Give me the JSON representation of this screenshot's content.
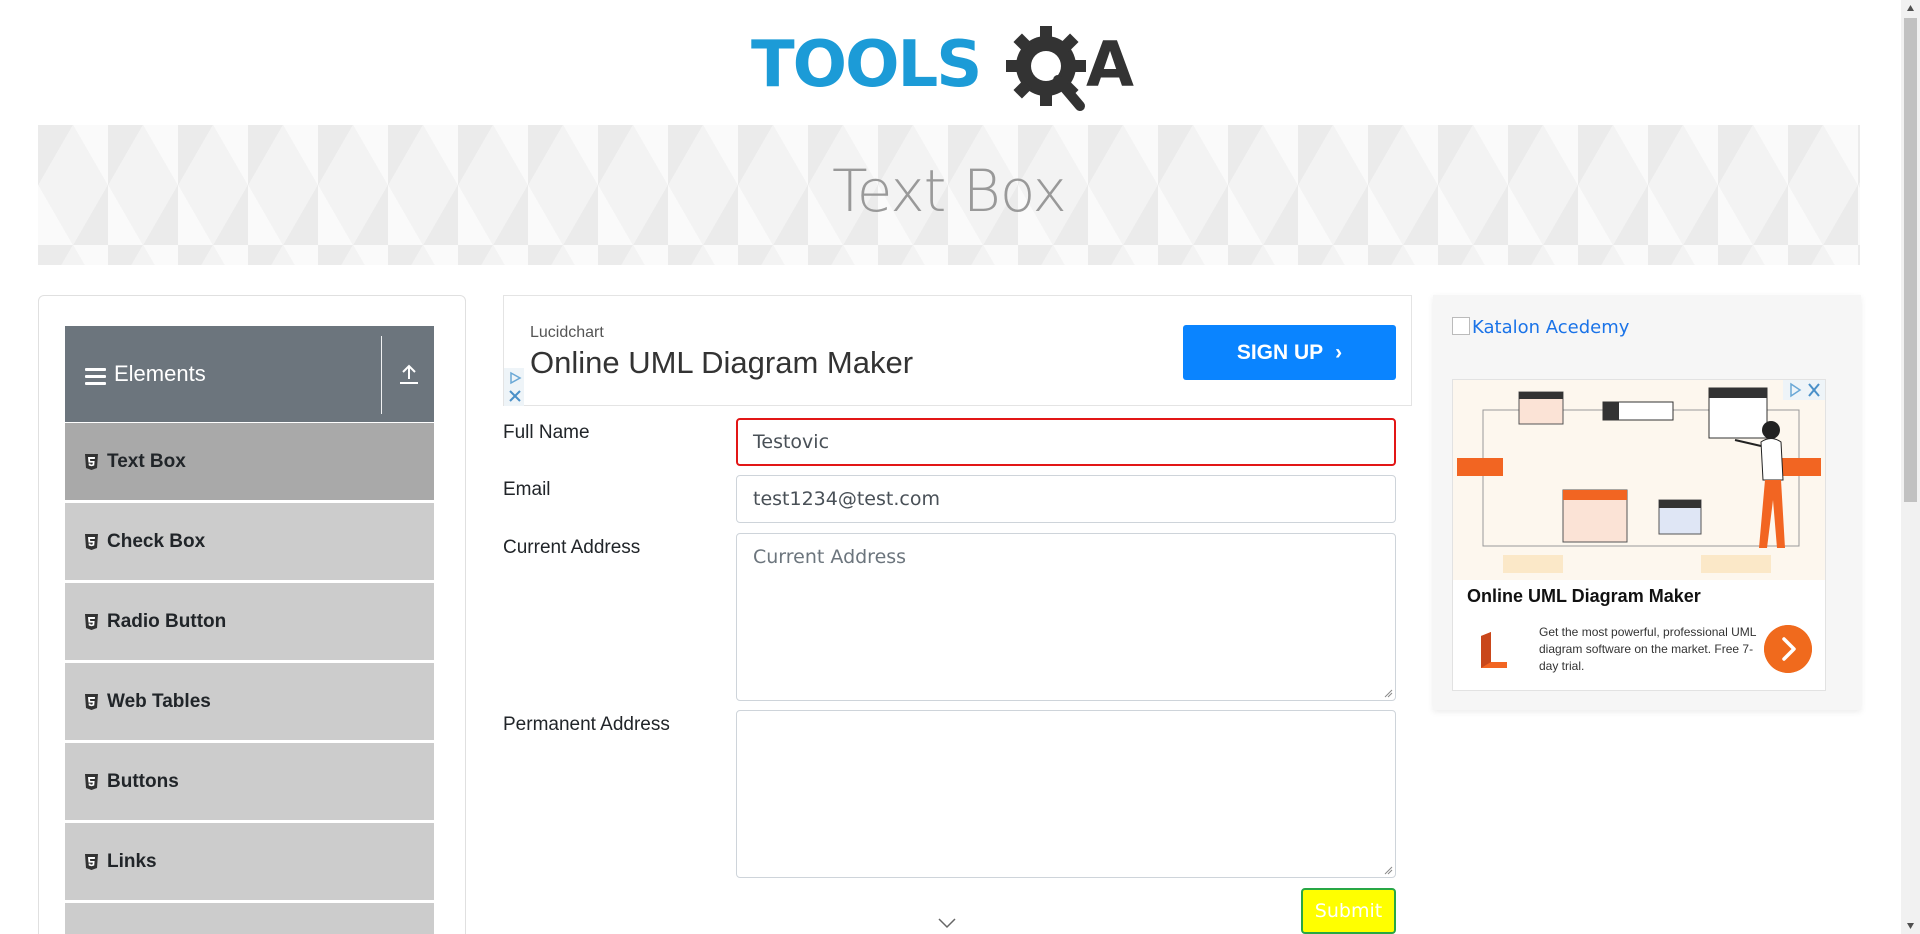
{
  "header": {
    "logo_alt": "TOOLSQA"
  },
  "banner": {
    "title": "Text Box"
  },
  "sidebar": {
    "group_title": "Elements",
    "items": [
      {
        "label": "Text Box",
        "active": true
      },
      {
        "label": "Check Box",
        "active": false
      },
      {
        "label": "Radio Button",
        "active": false
      },
      {
        "label": "Web Tables",
        "active": false
      },
      {
        "label": "Buttons",
        "active": false
      },
      {
        "label": "Links",
        "active": false
      }
    ]
  },
  "ad_top": {
    "brand": "Lucidchart",
    "headline": "Online UML Diagram Maker",
    "cta_label": "SIGN UP"
  },
  "form": {
    "full_name": {
      "label": "Full Name",
      "value": "Testovic",
      "error": true
    },
    "email": {
      "label": "Email",
      "value": "test1234@test.com"
    },
    "current_address": {
      "label": "Current Address",
      "value": "",
      "placeholder": "Current Address"
    },
    "permanent_address": {
      "label": "Permanent Address",
      "value": ""
    },
    "submit_label": "Submit"
  },
  "right_ad": {
    "link_text": "Katalon Acedemy",
    "title": "Online UML Diagram Maker",
    "description": "Get the most powerful, professional UML diagram software on the market. Free 7-day trial."
  },
  "colors": {
    "sidebar_header_bg": "#6c757d",
    "sidebar_item_bg": "#cccccc",
    "sidebar_item_active_bg": "#a9a9a9",
    "signup_button": "#0a84ff",
    "submit_bg": "#ffff00",
    "submit_border": "#28a745",
    "error_border": "#e21616",
    "lucid_orange": "#f06a1d"
  },
  "icons": {
    "menu": "hamburger-icon",
    "collapse": "upload-arrow-icon",
    "menu_item": "html5-shield-icon"
  }
}
